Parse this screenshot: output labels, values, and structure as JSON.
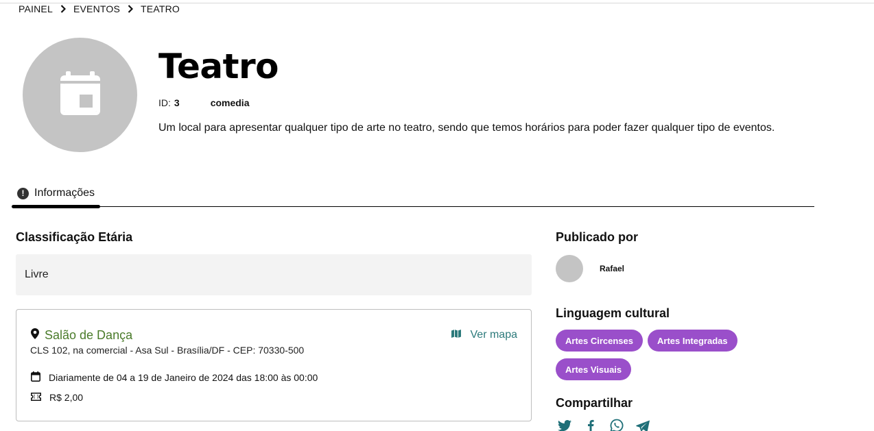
{
  "breadcrumb": {
    "items": [
      "PAINEL",
      "EVENTOS",
      "TEATRO"
    ]
  },
  "event": {
    "title": "Teatro",
    "id_label": "ID:",
    "id_value": "3",
    "type": "comedia",
    "description": "Um local para apresentar qualquer tipo de arte no teatro, sendo que temos horários para poder fazer qualquer tipo de eventos."
  },
  "tabs": [
    {
      "label": "Informações",
      "icon": "info-icon",
      "active": true
    }
  ],
  "age_rating": {
    "title": "Classificação Etária",
    "value": "Livre"
  },
  "location": {
    "name": "Salão de Dança",
    "address": "CLS 102, na comercial - Asa Sul - Brasília/DF - CEP: 70330-500",
    "map_link": "Ver mapa",
    "schedule": "Diariamente de 04 a 19 de Janeiro de 2024 das 18:00 às 00:00",
    "price": "R$ 2,00"
  },
  "publisher": {
    "title": "Publicado por",
    "name": "Rafael"
  },
  "cultural_language": {
    "title": "Linguagem cultural",
    "tags": [
      "Artes Circenses",
      "Artes Integradas",
      "Artes Visuais"
    ]
  },
  "share": {
    "title": "Compartilhar",
    "icons": [
      "twitter-icon",
      "facebook-icon",
      "whatsapp-icon",
      "telegram-icon"
    ]
  },
  "colors": {
    "location_name": "#4a7b2a",
    "map_link": "#2c7a7b",
    "tag_bg": "#9a4fca",
    "avatar_placeholder": "#c4c4c4",
    "share_icon": "#1f6f78"
  }
}
